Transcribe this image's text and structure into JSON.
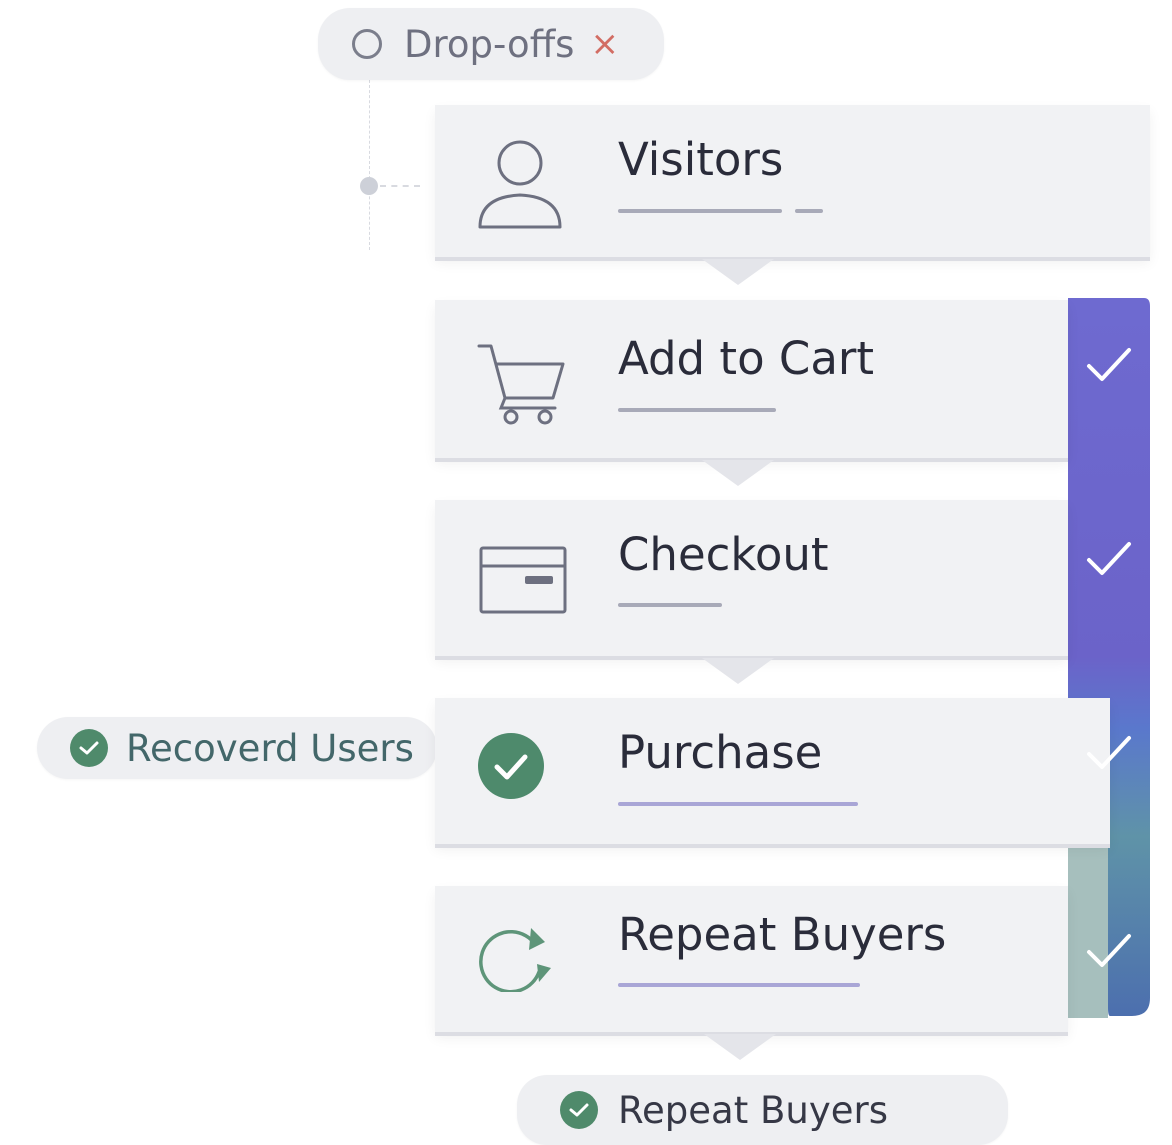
{
  "dropoffs": {
    "label": "Drop-offs",
    "close_glyph": "×",
    "close_color": "#d26d64"
  },
  "recovered": {
    "label": "Recoverd Users"
  },
  "repeat_pill": {
    "label": "Repeat Buyers"
  },
  "steps": [
    {
      "title": "Visitors",
      "icon": "person-icon",
      "completed": false
    },
    {
      "title": "Add to Cart",
      "icon": "shopping-cart-icon",
      "completed": true
    },
    {
      "title": "Checkout",
      "icon": "credit-card-icon",
      "completed": true
    },
    {
      "title": "Purchase",
      "icon": "check-circle-icon",
      "completed": true
    },
    {
      "title": "Repeat Buyers",
      "icon": "refresh-icon",
      "completed": true
    }
  ],
  "colors": {
    "accent_purple": "#6f67cf",
    "accent_blue": "#4f79b8",
    "success_green": "#4f8a6b",
    "card_bg": "#f1f2f4"
  }
}
